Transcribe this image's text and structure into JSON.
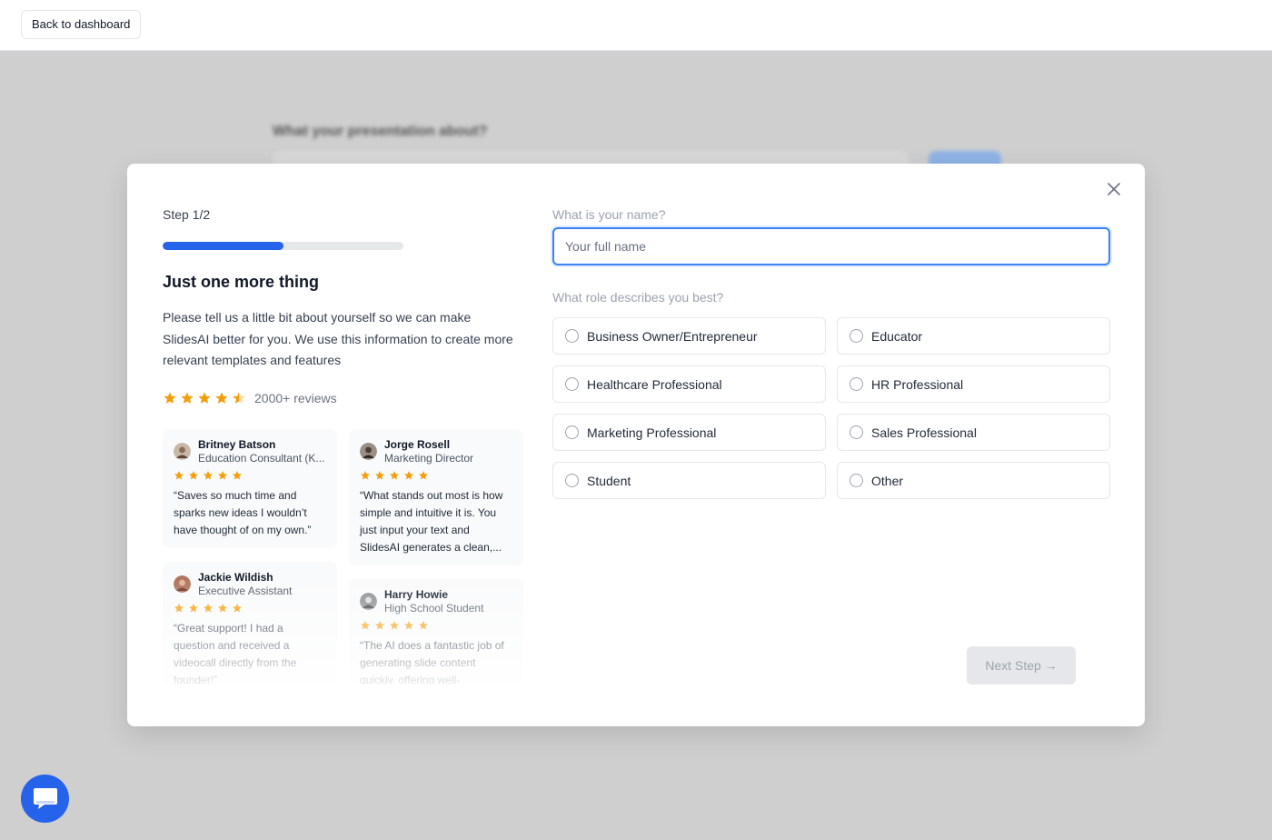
{
  "topbar": {
    "back_label": "Back to dashboard"
  },
  "background": {
    "heading": "What your presentation about?"
  },
  "modal": {
    "step": "Step 1/2",
    "progress": 0.5,
    "title": "Just one more thing",
    "description": "Please tell us a little bit about yourself so we can make SlidesAI better for you. We use this information to create more relevant templates and features",
    "rating_stars": 4.5,
    "reviews_count": "2000+ reviews",
    "testimonials": [
      {
        "name": "Britney Batson",
        "role": "Education Consultant (K...",
        "stars": 5,
        "quote": "“Saves so much time and sparks new ideas I wouldn’t have thought of on my own.”"
      },
      {
        "name": "Jorge Rosell",
        "role": "Marketing Director",
        "stars": 5,
        "quote": "“What stands out most is how simple and intuitive it is. You just input your text and SlidesAI generates a clean,..."
      },
      {
        "name": "Jackie Wildish",
        "role": "Executive Assistant",
        "stars": 5,
        "quote": "“Great support! I had a question and received a videocall directly from the founder!”"
      },
      {
        "name": "Harry Howie",
        "role": "High School Student",
        "stars": 5,
        "quote": "“The AI does a fantastic job of generating slide content quickly, offering well-"
      }
    ],
    "name_label": "What is your name?",
    "name_placeholder": "Your full name",
    "name_value": "",
    "role_label": "What role describes you best?",
    "roles": [
      "Business Owner/Entrepreneur",
      "Educator",
      "Healthcare Professional",
      "HR Professional",
      "Marketing Professional",
      "Sales Professional",
      "Student",
      "Other"
    ],
    "next_label": "Next Step →"
  },
  "colors": {
    "accent": "#2563eb",
    "star": "#f59e0b",
    "overlay": "#cfcfcf"
  }
}
